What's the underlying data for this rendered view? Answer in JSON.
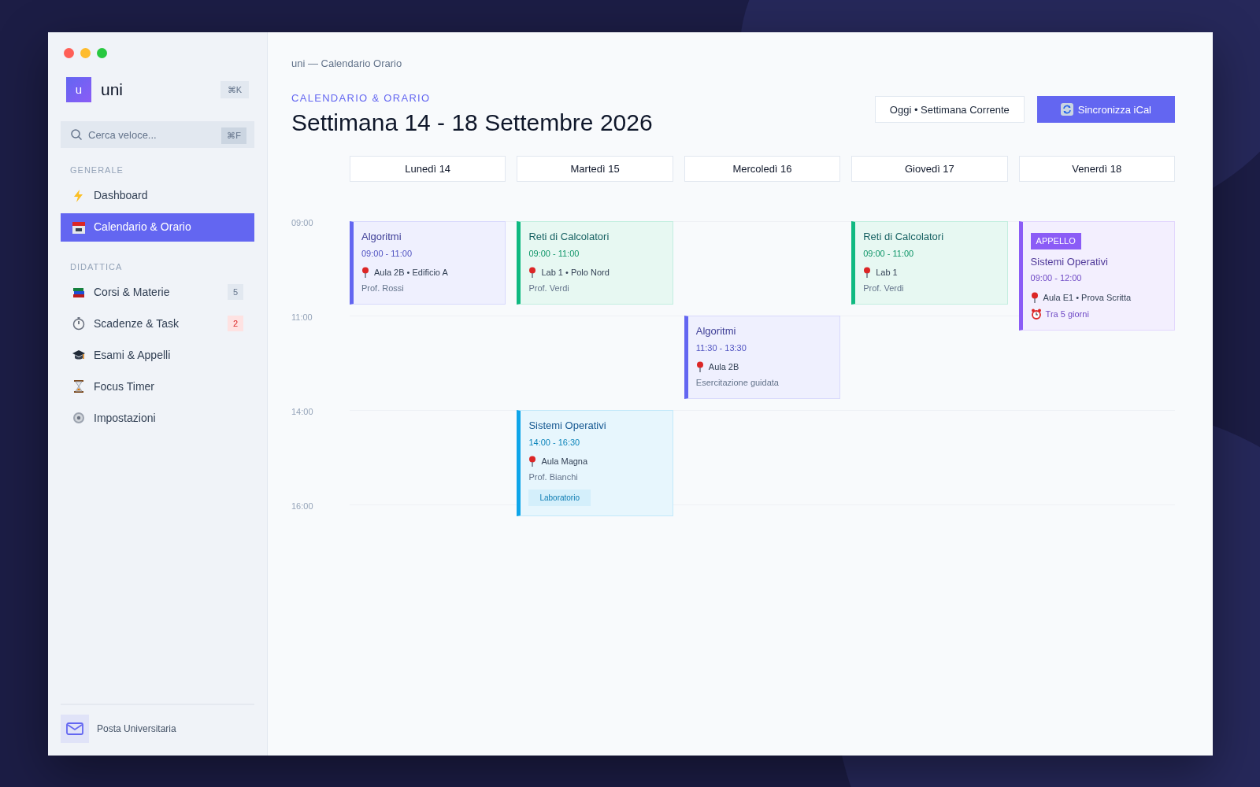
{
  "sidebar": {
    "logo": "u",
    "app_name": "uni",
    "shortcut": "⌘K",
    "search": {
      "placeholder": "Cerca veloce...",
      "shortcut": "⌘F"
    },
    "sections": [
      {
        "title": "GENERALE",
        "items": [
          {
            "label": "Dashboard",
            "selected": false
          },
          {
            "label": "Calendario & Orario",
            "selected": true
          }
        ]
      },
      {
        "title": "DIDATTICA",
        "items": [
          {
            "label": "Corsi & Materie",
            "selected": false,
            "count": "5",
            "color": "#e2e8f0"
          },
          {
            "label": "Scadenze & Task",
            "selected": false,
            "count": "2",
            "color": "#fee2e2"
          },
          {
            "label": "Esami & Appelli",
            "selected": false
          },
          {
            "label": "Focus Timer",
            "selected": false
          },
          {
            "label": "Impostazioni",
            "selected": false
          }
        ]
      }
    ],
    "footer": "Posta Universitaria"
  },
  "main": {
    "window_title": "uni — Calendario Orario",
    "eyebrow": "CALENDARIO & ORARIO",
    "title": "Settimana 14 - 18 Settembre 2026",
    "buttons": [
      {
        "label": "Oggi • Settimana Corrente",
        "kind": "outline"
      },
      {
        "label": "Sincronizza iCal",
        "kind": "primary"
      }
    ],
    "days": [
      "Lunedì 14",
      "Martedì 15",
      "Mercoledì 16",
      "Giovedì 17",
      "Venerdì 18"
    ],
    "schedule": [
      {
        "time": "09:00",
        "cells": [
          {
            "kind": "event",
            "color": "#6366f1",
            "title": "Algoritmi",
            "time": "09:00 - 11:00",
            "location": "Aula 2B • Edificio A",
            "note": "Prof. Rossi"
          },
          {
            "kind": "event",
            "color": "#10b981",
            "title": "Reti di Calcolatori",
            "time": "09:00 - 11:00",
            "location": "Lab 1 • Polo Nord",
            "note": "Prof. Verdi"
          },
          {
            "kind": "empty"
          },
          {
            "kind": "event",
            "color": "#10b981",
            "title": "Reti di Calcolatori",
            "time": "09:00 - 11:00",
            "location": "Lab 1",
            "note": "Prof. Verdi"
          },
          {
            "kind": "event",
            "color": "#8b5cf6",
            "badge": "APPELLO",
            "title": "Sistemi Operativi",
            "time": "09:00 - 12:00",
            "location": "Aula E1 • Prova Scritta",
            "reminder": "Tra 5 giorni"
          }
        ]
      },
      {
        "time": "11:00",
        "cells": [
          {
            "kind": "empty"
          },
          {
            "kind": "empty"
          },
          {
            "kind": "event",
            "color": "#6366f1",
            "title": "Algoritmi",
            "time": "11:30 - 13:30",
            "location": "Aula 2B",
            "note": "Esercitazione guidata"
          },
          {
            "kind": "empty"
          },
          {
            "kind": "empty"
          }
        ]
      },
      {
        "time": "14:00",
        "cells": [
          {
            "kind": "empty"
          },
          {
            "kind": "event",
            "color": "#0ea5e9",
            "title": "Sistemi Operativi",
            "time": "14:00 - 16:30",
            "location": "Aula Magna",
            "note": "Prof. Bianchi",
            "tag": "Laboratorio"
          },
          {
            "kind": "empty"
          },
          {
            "kind": "empty"
          },
          {
            "kind": "empty"
          }
        ]
      },
      {
        "time": "16:00",
        "cells": [
          {
            "kind": "empty"
          },
          {
            "kind": "empty"
          },
          {
            "kind": "empty"
          },
          {
            "kind": "empty"
          },
          {
            "kind": "empty"
          }
        ]
      }
    ]
  }
}
